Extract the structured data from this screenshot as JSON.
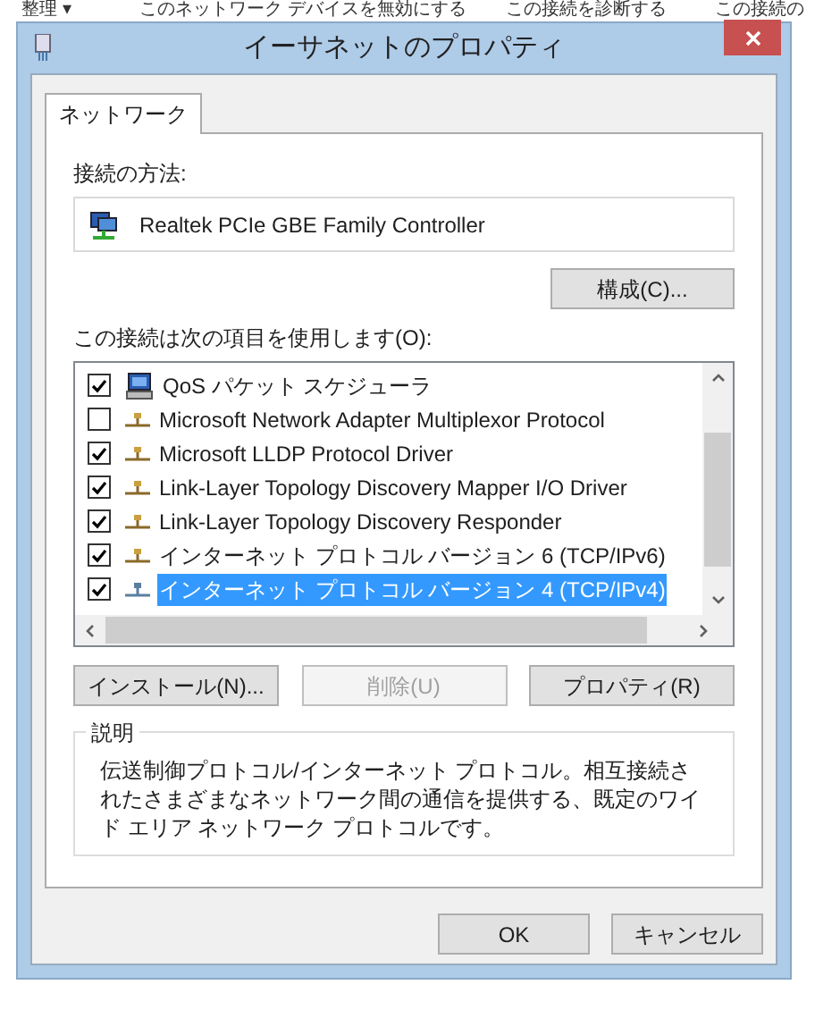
{
  "background_toolbar": [
    "整理 ▾",
    "このネットワーク デバイスを無効にする",
    "この接続を診断する",
    "この接続の"
  ],
  "window": {
    "title": "イーサネットのプロパティ"
  },
  "tabs": [
    {
      "label": "ネットワーク",
      "selected": true
    }
  ],
  "connect_using": {
    "label": "接続の方法:",
    "adapter": "Realtek PCIe GBE Family Controller",
    "configure_button": "構成(C)..."
  },
  "items_label": "この接続は次の項目を使用します(O):",
  "items": [
    {
      "kind": "service",
      "label": "QoS パケット スケジューラ",
      "checked": true,
      "selected": false
    },
    {
      "kind": "protocol",
      "label": "Microsoft Network Adapter Multiplexor Protocol",
      "checked": false,
      "selected": false
    },
    {
      "kind": "protocol",
      "label": "Microsoft LLDP Protocol Driver",
      "checked": true,
      "selected": false
    },
    {
      "kind": "protocol",
      "label": "Link-Layer Topology Discovery Mapper I/O Driver",
      "checked": true,
      "selected": false
    },
    {
      "kind": "protocol",
      "label": "Link-Layer Topology Discovery Responder",
      "checked": true,
      "selected": false
    },
    {
      "kind": "protocol",
      "label": "インターネット プロトコル バージョン 6 (TCP/IPv6)",
      "checked": true,
      "selected": false
    },
    {
      "kind": "protocol",
      "label": "インターネット プロトコル バージョン 4 (TCP/IPv4)",
      "checked": true,
      "selected": true
    }
  ],
  "item_buttons": [
    {
      "label": "インストール(N)...",
      "disabled": false
    },
    {
      "label": "削除(U)",
      "disabled": true
    },
    {
      "label": "プロパティ(R)",
      "disabled": false
    }
  ],
  "description": {
    "title": "説明",
    "text": "伝送制御プロトコル/インターネット プロトコル。相互接続されたさまざまなネットワーク間の通信を提供する、既定のワイド エリア ネットワーク プロトコルです。"
  },
  "dialog_buttons": [
    "OK",
    "キャンセル"
  ]
}
